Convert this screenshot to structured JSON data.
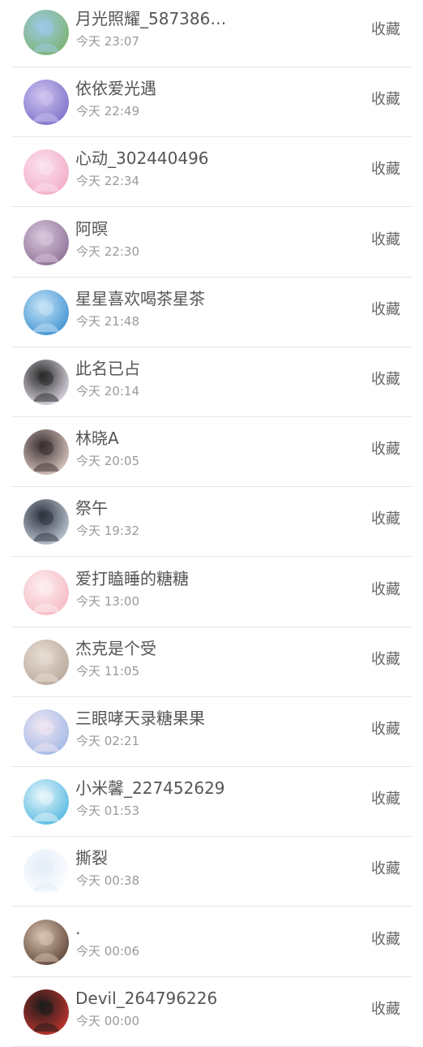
{
  "action_label": "收藏",
  "items": [
    {
      "name": "月光照耀_587386…",
      "time": "今天 23:07",
      "avatar_colors": [
        "#9ec9e8",
        "#7bb36a"
      ]
    },
    {
      "name": "依依爱光遇",
      "time": "今天 22:49",
      "avatar_colors": [
        "#cfc3f0",
        "#7b6fc9"
      ]
    },
    {
      "name": "心动_302440496",
      "time": "今天 22:34",
      "avatar_colors": [
        "#fbe3ee",
        "#f2a9c6"
      ]
    },
    {
      "name": "阿暝",
      "time": "今天 22:30",
      "avatar_colors": [
        "#d9c6dc",
        "#8a6f94"
      ]
    },
    {
      "name": "星星喜欢喝茶星茶",
      "time": "今天 21:48",
      "avatar_colors": [
        "#c7e4f6",
        "#3a8fd1"
      ]
    },
    {
      "name": "此名已占",
      "time": "今天 20:14",
      "avatar_colors": [
        "#2a2a2a",
        "#e8e2ee"
      ]
    },
    {
      "name": "林晓A",
      "time": "今天 20:05",
      "avatar_colors": [
        "#3b3032",
        "#e3cfc8"
      ]
    },
    {
      "name": "祭午",
      "time": "今天 19:32",
      "avatar_colors": [
        "#2d3440",
        "#c6d0dc"
      ]
    },
    {
      "name": "爱打瞌睡的糖糖",
      "time": "今天 13:00",
      "avatar_colors": [
        "#fdeef0",
        "#f4b8c2"
      ]
    },
    {
      "name": "杰克是个受",
      "time": "今天 11:05",
      "avatar_colors": [
        "#e8ddd3",
        "#b8a79a"
      ]
    },
    {
      "name": "三眼哮天录糖果果",
      "time": "今天 02:21",
      "avatar_colors": [
        "#f0e6f2",
        "#9fb7e6"
      ]
    },
    {
      "name": "小米馨_227452629",
      "time": "今天 01:53",
      "avatar_colors": [
        "#e8f6fb",
        "#4fb7e0"
      ]
    },
    {
      "name": "撕裂",
      "time": "今天 00:38",
      "avatar_colors": [
        "#e3edf8",
        "#ffffff"
      ]
    },
    {
      "name": ".",
      "time": "今天 00:06",
      "avatar_colors": [
        "#d8c3b0",
        "#5a4034"
      ]
    },
    {
      "name": "Devil_264796226",
      "time": "今天 00:00",
      "avatar_colors": [
        "#1c1c1c",
        "#c8352e"
      ]
    }
  ]
}
